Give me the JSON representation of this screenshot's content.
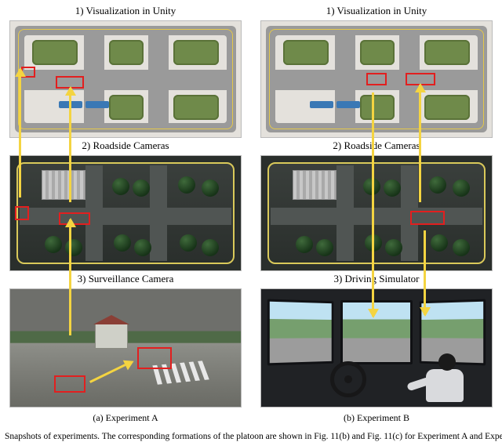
{
  "left": {
    "panel1_title": "1) Visualization in Unity",
    "panel2_title": "2) Roadside Cameras",
    "panel3_title": "3) Surveillance Camera",
    "subcaption": "(a) Experiment A"
  },
  "right": {
    "panel1_title": "1) Visualization in Unity",
    "panel2_title": "2) Roadside Cameras",
    "panel3_title": "3) Driving Simulator",
    "subcaption": "(b) Experiment B"
  },
  "caption": "Snapshots of experiments. The corresponding formations of the platoon are shown in Fig. 11(b) and Fig. 11(c) for Experiment A and Expe"
}
